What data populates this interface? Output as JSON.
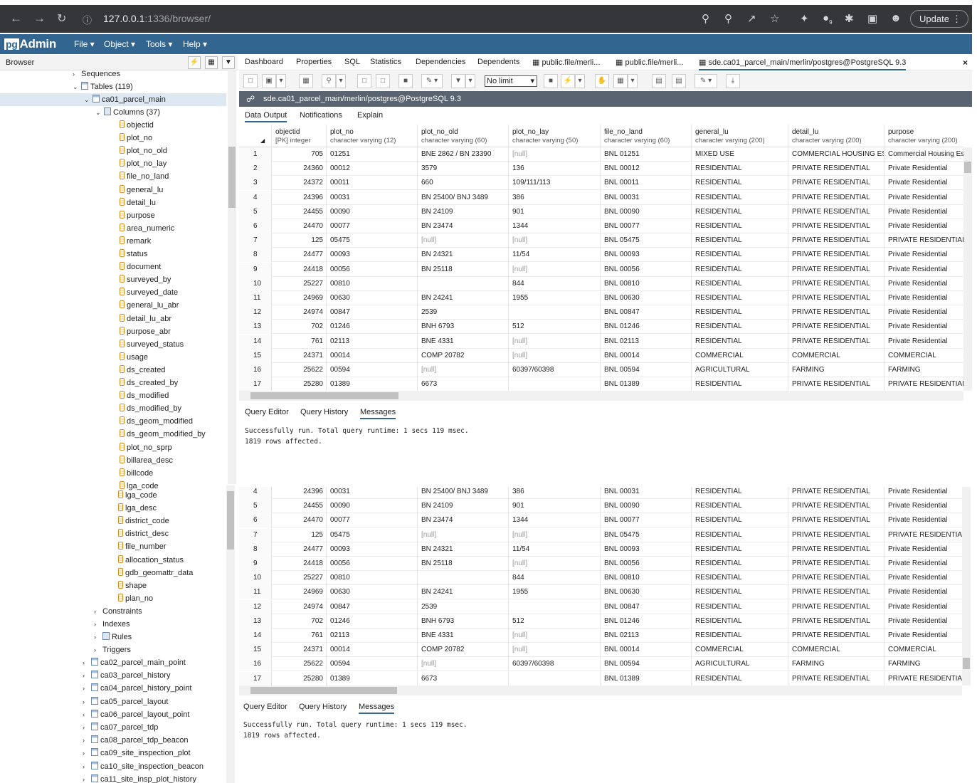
{
  "browser_chrome": {
    "url_host": "127.0.0.1",
    "url_port": ":1336",
    "url_path": "/browser/",
    "update_label": "Update",
    "extension_badge": "9"
  },
  "app": {
    "logo_pg": "pg",
    "logo_admin": "Admin",
    "menu": [
      "File",
      "Object",
      "Tools",
      "Help"
    ]
  },
  "browser_panel": {
    "title": "Browser"
  },
  "tree": {
    "sequences": "Sequences",
    "tables": "Tables (119)",
    "selected_table": "ca01_parcel_main",
    "columns": "Columns (37)",
    "column_items": [
      "objectid",
      "plot_no",
      "plot_no_old",
      "plot_no_lay",
      "file_no_land",
      "general_lu",
      "detail_lu",
      "purpose",
      "area_numeric",
      "remark",
      "status",
      "document",
      "surveyed_by",
      "surveyed_date",
      "general_lu_abr",
      "detail_lu_abr",
      "purpose_abr",
      "surveyed_status",
      "usage",
      "ds_created",
      "ds_created_by",
      "ds_modified",
      "ds_modified_by",
      "ds_geom_modified",
      "ds_geom_modified_by",
      "plot_no_sprp",
      "billarea_desc",
      "billcode",
      "lga_code"
    ],
    "column_items_lower": [
      "lga_code",
      "lga_desc",
      "district_code",
      "district_desc",
      "file_number",
      "allocation_status",
      "gdb_geomattr_data",
      "shape",
      "plan_no"
    ],
    "constraints": "Constraints",
    "indexes": "Indexes",
    "rules": "Rules",
    "triggers": "Triggers",
    "other_tables": [
      "ca02_parcel_main_point",
      "ca03_parcel_history",
      "ca04_parcel_history_point",
      "ca05_parcel_layout",
      "ca06_parcel_layout_point",
      "ca07_parcel_tdp",
      "ca08_parcel_tdp_beacon",
      "ca09_site_inspection_plot",
      "ca10_site_inspection_beacon",
      "ca11_site_insp_plot_history"
    ]
  },
  "tabs": [
    "Dashboard",
    "Properties",
    "SQL",
    "Statistics",
    "Dependencies",
    "Dependents",
    "public.file/merli...",
    "public.file/merli...",
    "sde.ca01_parcel_main/merlin/postgres@PostgreSQL 9.3"
  ],
  "query_toolbar": {
    "limit": "No limit"
  },
  "query_title": "sde.ca01_parcel_main/merlin/postgres@PostgreSQL 9.3",
  "result_tabs": [
    "Data Output",
    "Notifications",
    "Explain"
  ],
  "editor_tabs": [
    "Query Editor",
    "Query History",
    "Messages"
  ],
  "columns": [
    {
      "name": "objectid",
      "type": "[PK] integer"
    },
    {
      "name": "plot_no",
      "type": "character varying (12)"
    },
    {
      "name": "plot_no_old",
      "type": "character varying (60)"
    },
    {
      "name": "plot_no_lay",
      "type": "character varying (50)"
    },
    {
      "name": "file_no_land",
      "type": "character varying (60)"
    },
    {
      "name": "general_lu",
      "type": "character varying (200)"
    },
    {
      "name": "detail_lu",
      "type": "character varying (200)"
    },
    {
      "name": "purpose",
      "type": "character varying (200)"
    }
  ],
  "rows": [
    [
      "1",
      "705",
      "01251",
      "BNE 2862 / BN 23390",
      "[null]",
      "BNL 01251",
      "MIXED USE",
      "COMMERCIAL HOUSING ES...",
      "Commercial Housing Est"
    ],
    [
      "2",
      "24360",
      "00012",
      "3579",
      "136",
      "BNL 00012",
      "RESIDENTIAL",
      "PRIVATE RESIDENTIAL",
      "Private Residential"
    ],
    [
      "3",
      "24372",
      "00011",
      "660",
      "109/111/113",
      "BNL 00011",
      "RESIDENTIAL",
      "PRIVATE RESIDENTIAL",
      "Private Residential"
    ],
    [
      "4",
      "24396",
      "00031",
      "BN 25400/ BNJ 3489",
      "386",
      "BNL 00031",
      "RESIDENTIAL",
      "PRIVATE RESIDENTIAL",
      "Private Residential"
    ],
    [
      "5",
      "24455",
      "00090",
      "BN 24109",
      "901",
      "BNL 00090",
      "RESIDENTIAL",
      "PRIVATE RESIDENTIAL",
      "Private Residential"
    ],
    [
      "6",
      "24470",
      "00077",
      "BN 23474",
      "1344",
      "BNL 00077",
      "RESIDENTIAL",
      "PRIVATE RESIDENTIAL",
      "Private Residential"
    ],
    [
      "7",
      "125",
      "05475",
      "[null]",
      "[null]",
      "BNL 05475",
      "RESIDENTIAL",
      "PRIVATE RESIDENTIAL",
      "PRIVATE RESIDENTIAL"
    ],
    [
      "8",
      "24477",
      "00093",
      "BN 24321",
      "11/54",
      "BNL 00093",
      "RESIDENTIAL",
      "PRIVATE RESIDENTIAL",
      "Private Residential"
    ],
    [
      "9",
      "24418",
      "00056",
      "BN 25118",
      "[null]",
      "BNL 00056",
      "RESIDENTIAL",
      "PRIVATE RESIDENTIAL",
      "Private Residential"
    ],
    [
      "10",
      "25227",
      "00810",
      "",
      "844",
      "BNL 00810",
      "RESIDENTIAL",
      "PRIVATE RESIDENTIAL",
      "Private Residential"
    ],
    [
      "11",
      "24969",
      "00630",
      "BN 24241",
      "1955",
      "BNL 00630",
      "RESIDENTIAL",
      "PRIVATE RESIDENTIAL",
      "Private Residential"
    ],
    [
      "12",
      "24974",
      "00847",
      "2539",
      "",
      "BNL 00847",
      "RESIDENTIAL",
      "PRIVATE RESIDENTIAL",
      "Private Residential"
    ],
    [
      "13",
      "702",
      "01246",
      "BNH 6793",
      "512",
      "BNL 01246",
      "RESIDENTIAL",
      "PRIVATE RESIDENTIAL",
      "Private Residential"
    ],
    [
      "14",
      "761",
      "02113",
      "BNE 4331",
      "[null]",
      "BNL 02113",
      "RESIDENTIAL",
      "PRIVATE RESIDENTIAL",
      "Private Residential"
    ],
    [
      "15",
      "24371",
      "00014",
      "COMP 20782",
      "[null]",
      "BNL 00014",
      "COMMERCIAL",
      "COMMERCIAL",
      "COMMERCIAL"
    ],
    [
      "16",
      "25622",
      "00594",
      "[null]",
      "60397/60398",
      "BNL 00594",
      "AGRICULTURAL",
      "FARMING",
      "FARMING"
    ],
    [
      "17",
      "25280",
      "01389",
      "6673",
      "",
      "BNL 01389",
      "RESIDENTIAL",
      "PRIVATE RESIDENTIAL",
      "PRIVATE RESIDENTIAL"
    ]
  ],
  "messages": [
    "Successfully run. Total query runtime: 1 secs 119 msec.",
    "1819 rows affected."
  ]
}
